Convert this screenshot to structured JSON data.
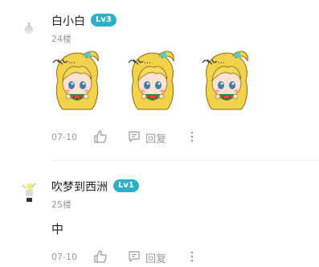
{
  "comments": [
    {
      "username": "白小白",
      "level": "Lv3",
      "floor": "24楼",
      "content": "",
      "stickers": [
        "sticker-chibi-girl-eating",
        "sticker-chibi-girl-eating",
        "sticker-chibi-girl-eating"
      ],
      "date": "07-10",
      "reply_label": "回复"
    },
    {
      "username": "吹梦到西洲",
      "level": "Lv1",
      "floor": "25楼",
      "content": "中",
      "date": "07-10",
      "reply_label": "回复"
    }
  ],
  "colors": {
    "level_badge": "#2cb0c6",
    "muted_text": "#999999",
    "divider": "#eeeeee"
  },
  "icons": [
    "like-icon",
    "reply-icon",
    "more-icon"
  ]
}
